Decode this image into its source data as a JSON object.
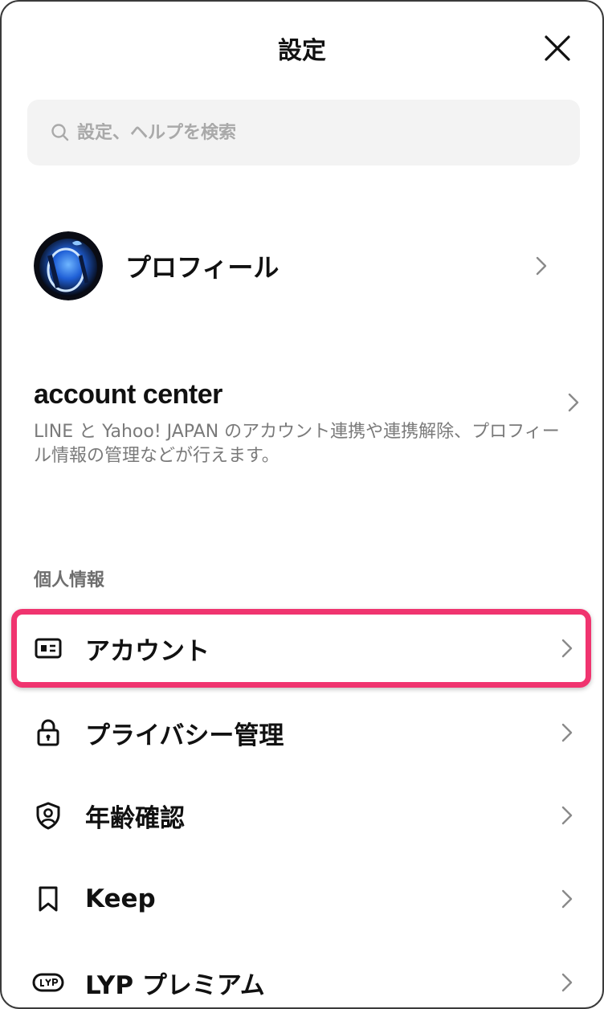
{
  "header": {
    "title": "設定",
    "close_icon": "close-icon"
  },
  "search": {
    "placeholder": "設定、ヘルプを検索",
    "value": "",
    "icon": "search-icon"
  },
  "profile": {
    "label": "プロフィール"
  },
  "account_center": {
    "title": "account center",
    "description": "LINE と Yahoo! JAPAN のアカウント連携や連携解除、プロフィール情報の管理などが行えます。"
  },
  "personal_info": {
    "section_label": "個人情報",
    "items": [
      {
        "label": "アカウント",
        "icon": "id-card-icon",
        "highlighted": true
      },
      {
        "label": "プライバシー管理",
        "icon": "lock-icon"
      },
      {
        "label": "年齢確認",
        "icon": "shield-person-icon"
      },
      {
        "label": "Keep",
        "icon": "bookmark-icon"
      },
      {
        "label": "LYP プレミアム",
        "icon": "lyp-badge-icon"
      }
    ]
  },
  "colors": {
    "highlight": "#f0346f",
    "search_bg": "#f3f3f3",
    "secondary_text": "#7a7a7a"
  }
}
